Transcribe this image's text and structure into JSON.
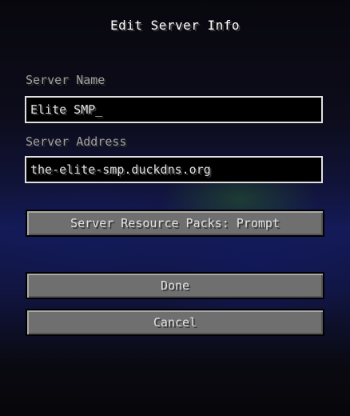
{
  "screen": {
    "title": "Edit Server Info"
  },
  "form": {
    "server_name_label": "Server Name",
    "server_name_value": "Elite SMP",
    "server_name_caret": "_",
    "server_address_label": "Server Address",
    "server_address_value": "the-elite-smp.duckdns.org"
  },
  "buttons": {
    "resource_packs": "Server Resource Packs: Prompt",
    "done": "Done",
    "cancel": "Cancel"
  }
}
